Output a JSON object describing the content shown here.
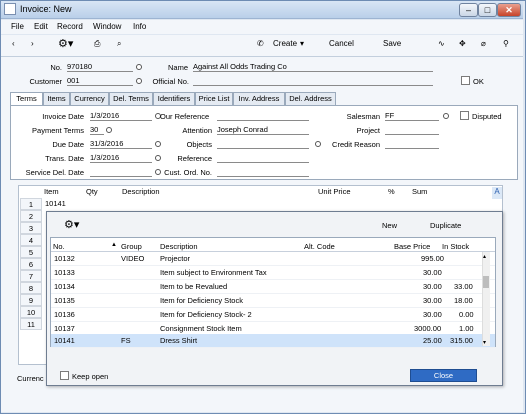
{
  "window": {
    "title": "Invoice: New"
  },
  "menu": [
    "File",
    "Edit",
    "Record",
    "Window",
    "Info"
  ],
  "toolbar": {
    "create": "Create",
    "cancel": "Cancel",
    "save": "Save"
  },
  "header": {
    "no_label": "No.",
    "no_value": "970180",
    "name_label": "Name",
    "name_value": "Against All Odds Trading Co",
    "customer_label": "Customer",
    "customer_value": "001",
    "official_label": "Official No.",
    "ok_label": "OK"
  },
  "tabs": [
    "Terms",
    "Items",
    "Currency",
    "Del. Terms",
    "Identifiers",
    "Price List",
    "Inv. Address",
    "Del. Address"
  ],
  "terms": {
    "invoice_date_label": "Invoice Date",
    "invoice_date": "1/3/2016",
    "our_ref_label": "Our Reference",
    "salesman_label": "Salesman",
    "salesman": "FF",
    "disputed_label": "Disputed",
    "payment_terms_label": "Payment Terms",
    "payment_terms": "30",
    "attention_label": "Attention",
    "attention": "Joseph Conrad",
    "project_label": "Project",
    "due_date_label": "Due Date",
    "due_date": "31/3/2016",
    "objects_label": "Objects",
    "credit_reason_label": "Credit Reason",
    "trans_date_label": "Trans. Date",
    "trans_date": "1/3/2016",
    "reference_label": "Reference",
    "service_del_label": "Service Del. Date",
    "cust_ord_label": "Cust. Ord. No."
  },
  "grid": {
    "headers": [
      "Item",
      "Qty",
      "Description",
      "Unit Price",
      "%",
      "Sum"
    ],
    "row1_item": "10141",
    "rownums": [
      "1",
      "2",
      "3",
      "4",
      "5",
      "6",
      "7",
      "8",
      "9",
      "10",
      "11"
    ],
    "a_marker": "A",
    "currency_label": "Currenc"
  },
  "popup": {
    "new": "New",
    "duplicate": "Duplicate",
    "headers": {
      "no": "No.",
      "group": "Group",
      "description": "Description",
      "alt_code": "Alt. Code",
      "base_price": "Base Price",
      "in_stock": "In Stock"
    },
    "rows": [
      {
        "no": "10132",
        "group": "VIDEO",
        "description": "Projector",
        "base_price": "995.00",
        "in_stock": ""
      },
      {
        "no": "10133",
        "group": "",
        "description": "Item subject to Environment Tax",
        "base_price": "30.00",
        "in_stock": ""
      },
      {
        "no": "10134",
        "group": "",
        "description": "Item to be Revalued",
        "base_price": "30.00",
        "in_stock": "33.00"
      },
      {
        "no": "10135",
        "group": "",
        "description": "Item for Deficiency Stock",
        "base_price": "30.00",
        "in_stock": "18.00"
      },
      {
        "no": "10136",
        "group": "",
        "description": "Item for Deficiency Stock- 2",
        "base_price": "30.00",
        "in_stock": "0.00"
      },
      {
        "no": "10137",
        "group": "",
        "description": "Consignment Stock Item",
        "base_price": "3000.00",
        "in_stock": "1.00"
      },
      {
        "no": "10141",
        "group": "FS",
        "description": "Dress Shirt",
        "base_price": "25.00",
        "in_stock": "315.00"
      }
    ],
    "keep_open": "Keep open",
    "close": "Close"
  }
}
